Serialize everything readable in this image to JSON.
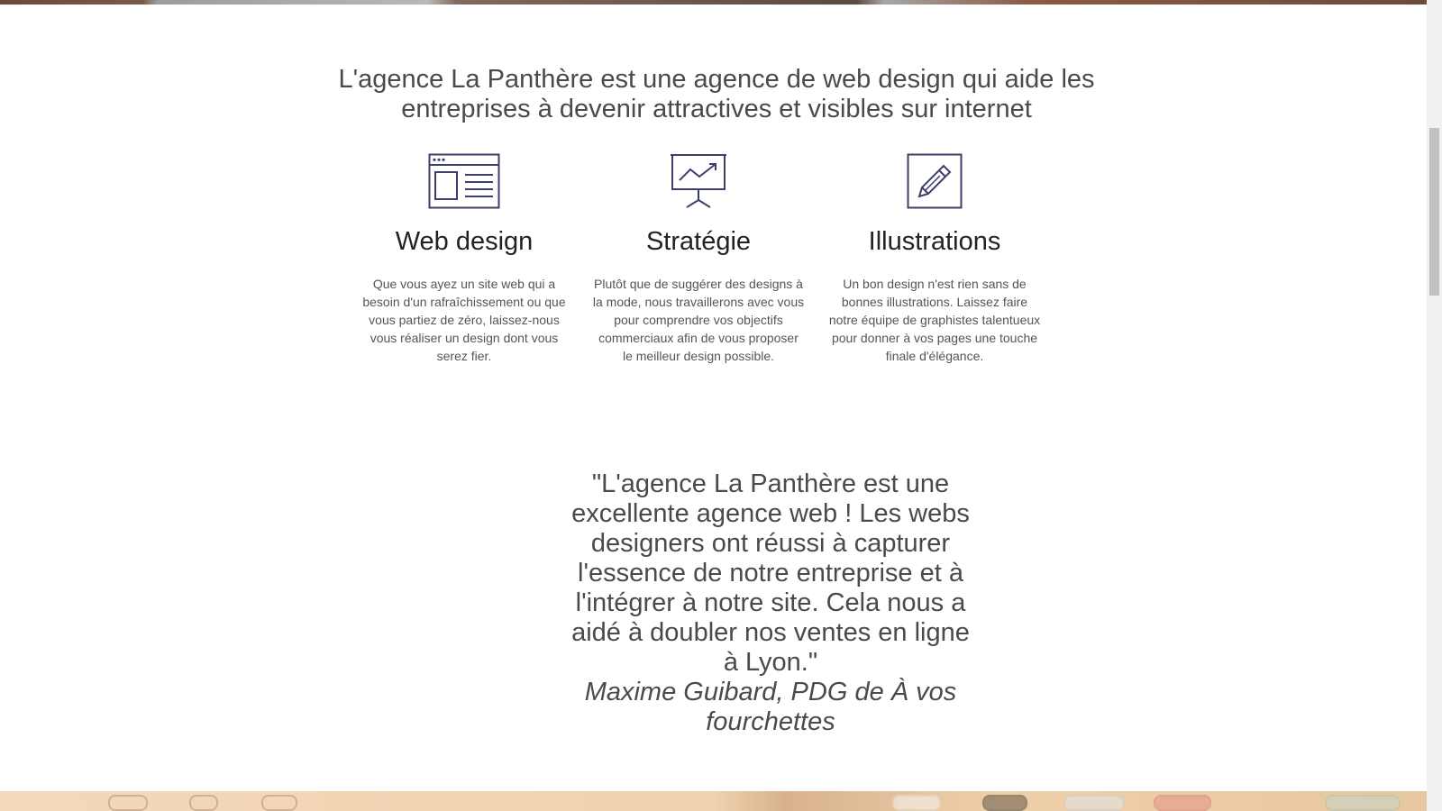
{
  "intro": {
    "text": "L'agence La Panthère est une agence de web design qui aide les entreprises à devenir attractives et visibles sur internet"
  },
  "services": [
    {
      "icon": "browser-window-icon",
      "title": "Web design",
      "description": "Que vous ayez un site web qui a besoin d'un rafraîchissement ou que vous partiez de zéro, laissez-nous vous réaliser un design dont vous serez fier."
    },
    {
      "icon": "presentation-chart-icon",
      "title": "Stratégie",
      "description": "Plutôt que de suggérer des designs à la mode, nous travaillerons avec vous pour comprendre vos objectifs commerciaux afin de vous proposer le meilleur design possible."
    },
    {
      "icon": "pencil-square-icon",
      "title": "Illustrations",
      "description": "Un bon design n'est rien sans de bonnes illustrations. Laissez faire notre équipe de graphistes talentueux pour donner à vos pages une touche finale d'élégance."
    }
  ],
  "testimonial": {
    "quote": "\"L'agence La Panthère est une excellente agence web ! Les webs designers ont réussi à capturer l'essence de notre entreprise et à l'intégrer à notre site. Cela nous a aidé à doubler nos ventes en ligne à Lyon.\"",
    "author": "Maxime Guibard, PDG de À vos fourchettes"
  },
  "colors": {
    "icon_stroke": "#3c3f6b",
    "text": "#4a4a4a",
    "heading": "#222222"
  }
}
